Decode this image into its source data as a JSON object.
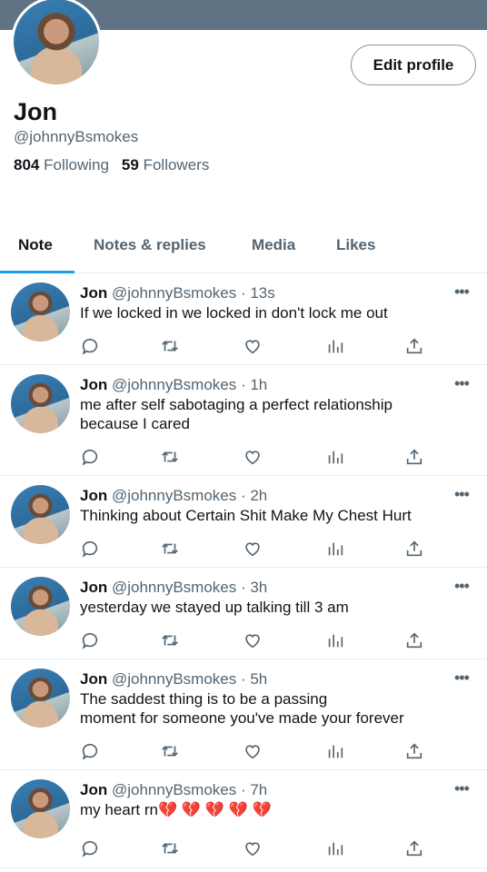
{
  "header": {
    "banner_color": "#5f7384",
    "edit_label": "Edit profile"
  },
  "profile": {
    "name": "Jon",
    "handle": "@johnnyBsmokes",
    "following_count": "804",
    "following_label": "Following",
    "followers_count": "59",
    "followers_label": "Followers"
  },
  "tabs": [
    {
      "label": "Note",
      "active": true
    },
    {
      "label": "Notes & replies",
      "active": false
    },
    {
      "label": "Media",
      "active": false
    },
    {
      "label": "Likes",
      "active": false
    }
  ],
  "tweets": [
    {
      "name": "Jon",
      "handle": "@johnnyBsmokes",
      "time": "· 13s",
      "text": "If we locked in we locked in don't lock me out",
      "more": "•••"
    },
    {
      "name": "Jon",
      "handle": "@johnnyBsmokes",
      "time": "· 1h",
      "text": "me after self sabotaging a perfect relationship\nbecause I cared",
      "more": "•••"
    },
    {
      "name": "Jon",
      "handle": "@johnnyBsmokes",
      "time": "· 2h",
      "text": "Thinking about Certain Shit Make My Chest Hurt",
      "more": "•••"
    },
    {
      "name": "Jon",
      "handle": "@johnnyBsmokes",
      "time": "· 3h",
      "text": "yesterday we stayed up talking till 3 am",
      "more": "•••"
    },
    {
      "name": "Jon",
      "handle": "@johnnyBsmokes",
      "time": "· 5h",
      "text": "The saddest thing is to be a passing\nmoment for someone you've made your forever",
      "more": "•••"
    },
    {
      "name": "Jon",
      "handle": "@johnnyBsmokes",
      "time": "· 7h",
      "text": "my heart rn💔 💔 💔 💔 💔",
      "more": "•••"
    }
  ],
  "action_icons": [
    "reply-icon",
    "retweet-icon",
    "like-icon",
    "analytics-icon",
    "share-icon"
  ],
  "colors": {
    "accent": "#1d9bf0",
    "secondary_text": "#536471"
  }
}
